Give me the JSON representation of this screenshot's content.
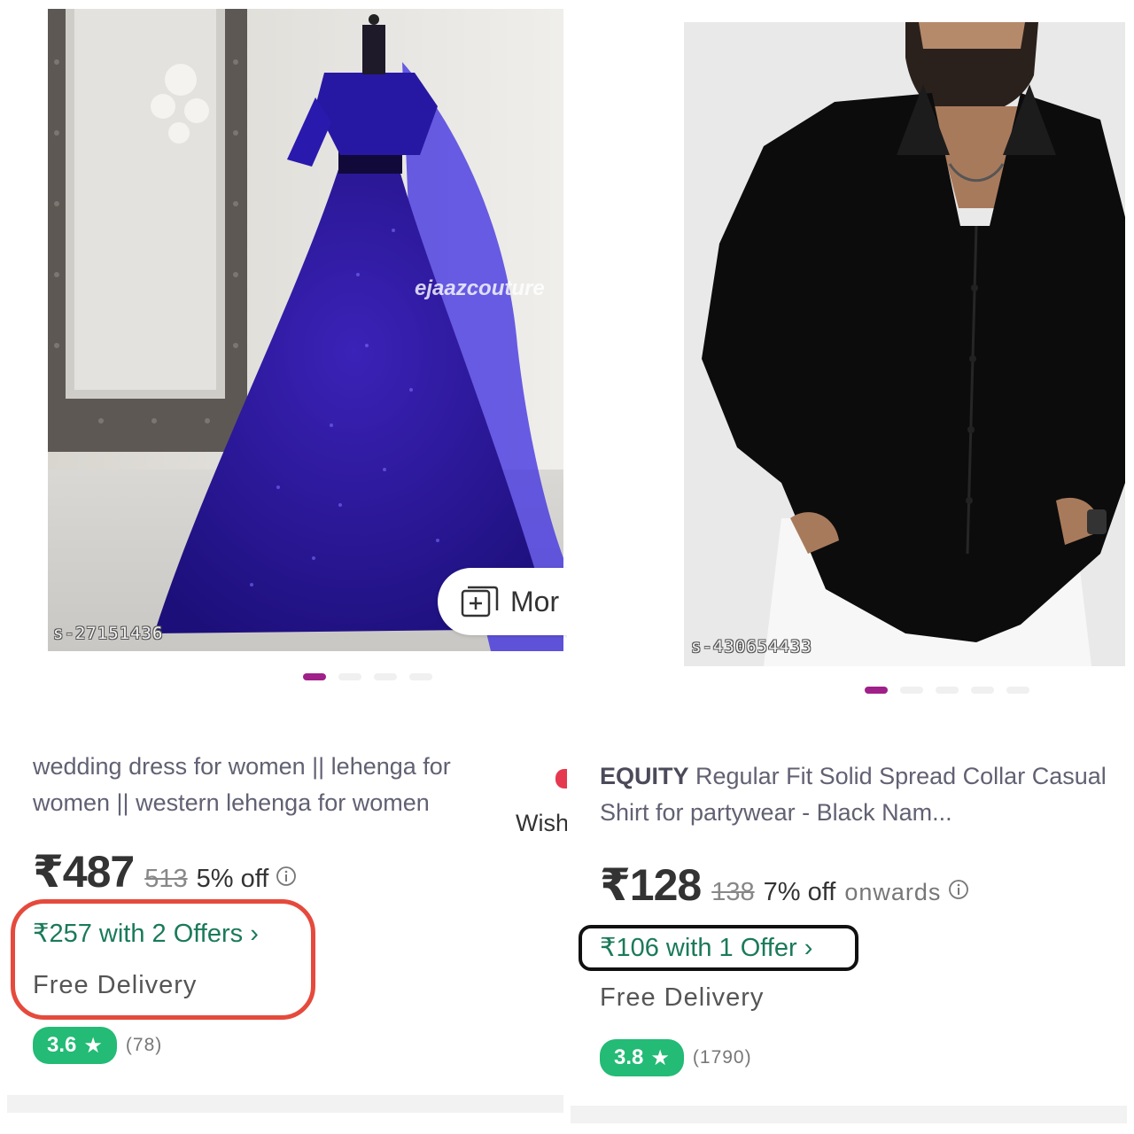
{
  "left_card": {
    "sku": "s-27151436",
    "watermark": "ejaazcouture",
    "more_label": "Mor",
    "title": "wedding dress for women || lehenga for women || western lehenga for women",
    "price": "₹487",
    "mrp": "513",
    "discount": "5% off",
    "offer_text": "₹257 with 2 Offers ›",
    "delivery": "Free Delivery",
    "rating": "3.6",
    "rating_count": "(78)",
    "wishlist_label": "Wish",
    "gallery_dots": 4,
    "active_dot": 0
  },
  "right_card": {
    "sku": "s-430654433",
    "brand": "EQUITY",
    "title": " Regular Fit Solid Spread Collar Casual Shirt for partywear - Black Nam...",
    "price": "₹128",
    "mrp": "138",
    "discount": "7% off",
    "onwards": "onwards",
    "offer_text": "₹106 with 1 Offer ›",
    "delivery": "Free Delivery",
    "rating": "3.8",
    "rating_count": "(1790)",
    "gallery_dots": 5,
    "active_dot": 0
  },
  "colors": {
    "accent": "#9f2089",
    "rating_green": "#23bb75",
    "offer_green": "#1a7a5a",
    "highlight_red": "#e54a3c"
  },
  "icons": [
    "gallery-icon",
    "info-icon",
    "star-icon",
    "chevron-right-icon",
    "heart-icon"
  ]
}
